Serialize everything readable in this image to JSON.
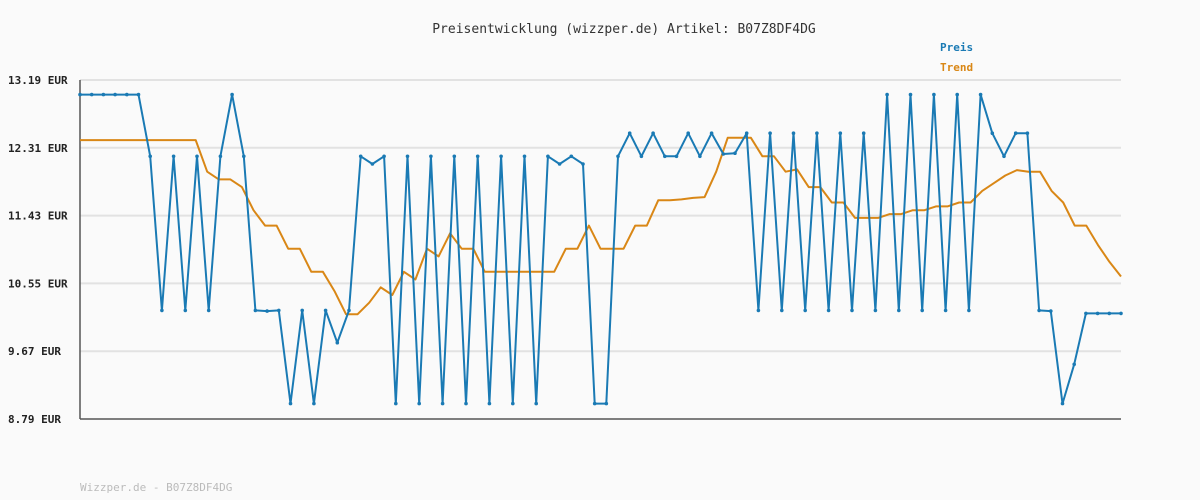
{
  "chart_data": {
    "type": "line",
    "title": "Preisentwicklung (wizzper.de) Artikel: B07Z8DF4DG",
    "footer": "Wizzper.de - B07Z8DF4DG",
    "ylim": [
      8.79,
      13.19
    ],
    "yticks": [
      "13.19 EUR",
      "12.31 EUR",
      "11.43 EUR",
      "10.55 EUR",
      "9.67 EUR",
      "8.79 EUR"
    ],
    "ytick_values": [
      13.19,
      12.31,
      11.43,
      10.55,
      9.67,
      8.79
    ],
    "grid": true,
    "legend_position": "top-right",
    "series": [
      {
        "name": "Preis",
        "color": "#1a7ab4",
        "values": [
          13.0,
          13.0,
          13.0,
          13.0,
          13.0,
          13.0,
          12.2,
          10.2,
          12.2,
          10.2,
          12.2,
          10.2,
          12.2,
          13.0,
          12.2,
          10.2,
          10.19,
          10.2,
          8.99,
          10.2,
          8.99,
          10.2,
          9.78,
          10.2,
          12.2,
          12.1,
          12.2,
          8.99,
          12.2,
          8.99,
          12.2,
          8.99,
          12.2,
          8.99,
          12.2,
          8.99,
          12.2,
          8.99,
          12.2,
          8.99,
          12.2,
          12.1,
          12.2,
          12.1,
          8.99,
          8.99,
          12.2,
          12.5,
          12.2,
          12.5,
          12.2,
          12.2,
          12.5,
          12.2,
          12.5,
          12.23,
          12.24,
          12.5,
          10.2,
          12.5,
          10.2,
          12.5,
          10.2,
          12.5,
          10.2,
          12.5,
          10.2,
          12.5,
          10.2,
          13.0,
          10.2,
          13.0,
          10.2,
          13.0,
          10.2,
          13.0,
          10.2,
          13.0,
          12.5,
          12.2,
          12.5,
          12.5,
          10.2,
          10.19,
          8.99,
          9.5,
          10.16,
          10.16,
          10.16,
          10.16
        ],
        "value_precision_note": ""
      },
      {
        "name": "Trend",
        "color": "#d98716",
        "values": [
          12.41,
          12.41,
          12.41,
          12.41,
          12.41,
          12.41,
          12.41,
          12.41,
          12.41,
          12.41,
          12.41,
          12.0,
          11.9,
          11.9,
          11.8,
          11.5,
          11.3,
          11.3,
          11.0,
          11.0,
          10.7,
          10.7,
          10.45,
          10.15,
          10.15,
          10.3,
          10.5,
          10.4,
          10.7,
          10.6,
          11.0,
          10.9,
          11.2,
          11.0,
          11.0,
          10.7,
          10.7,
          10.7,
          10.7,
          10.7,
          10.7,
          10.7,
          11.0,
          11.0,
          11.3,
          11.0,
          11.0,
          11.0,
          11.3,
          11.3,
          11.63,
          11.63,
          11.64,
          11.66,
          11.67,
          12.0,
          12.44,
          12.44,
          12.44,
          12.2,
          12.2,
          12.0,
          12.03,
          11.8,
          11.8,
          11.6,
          11.6,
          11.4,
          11.4,
          11.4,
          11.45,
          11.45,
          11.5,
          11.5,
          11.55,
          11.55,
          11.6,
          11.6,
          11.75,
          11.85,
          11.95,
          12.02,
          12.0,
          12.0,
          11.75,
          11.6,
          11.3,
          11.3,
          11.05,
          10.83,
          10.64
        ]
      }
    ]
  }
}
